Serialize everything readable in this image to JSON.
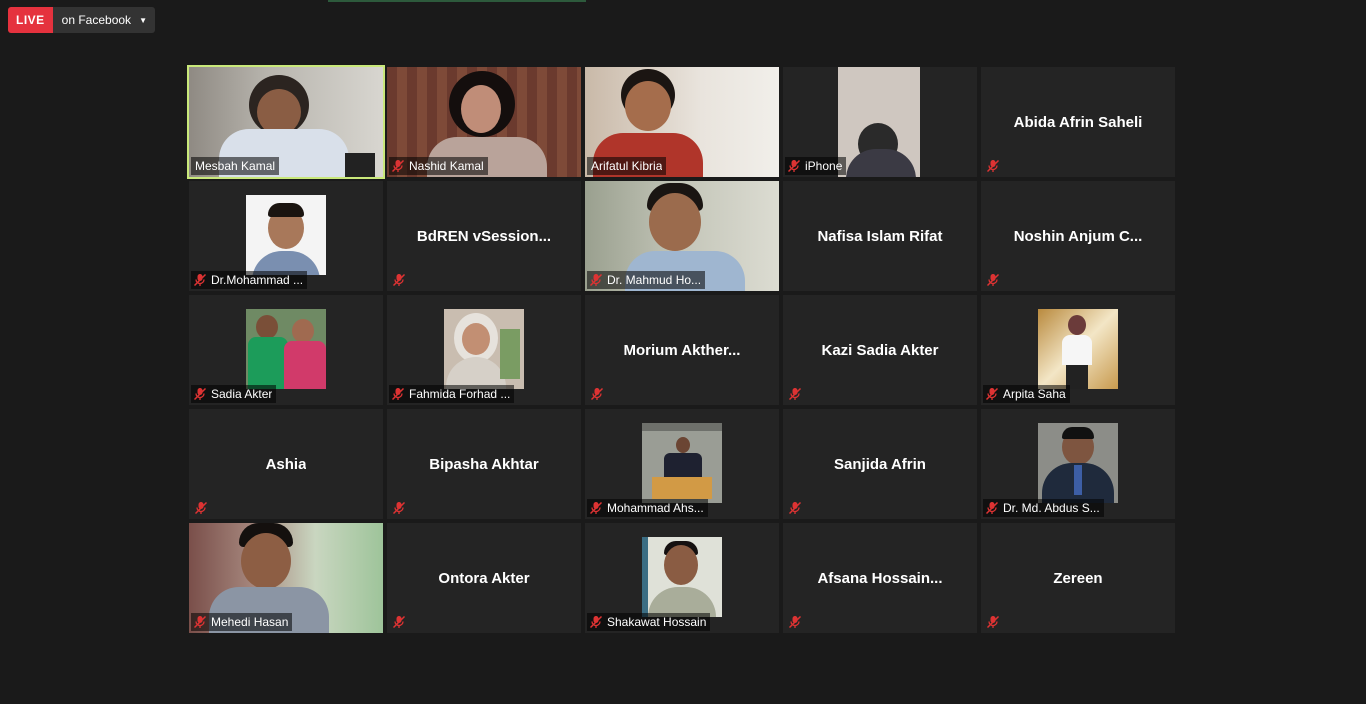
{
  "live": {
    "tag": "LIVE",
    "destination": "on Facebook"
  },
  "colors": {
    "background": "#1a1a1a",
    "tile": "#242424",
    "active_border": "#c9e87a",
    "live_red": "#e5323e"
  },
  "participants": [
    {
      "name": "Mesbah Kamal",
      "video": true,
      "muted": false,
      "active": true
    },
    {
      "name": "Nashid Kamal",
      "video": true,
      "muted": true
    },
    {
      "name": "Arifatul Kibria",
      "video": true,
      "muted": false
    },
    {
      "name": "iPhone",
      "video": false,
      "photo": true,
      "muted": true
    },
    {
      "name": "Abida Afrin Saheli",
      "video": false,
      "muted": true
    },
    {
      "name": "Dr.Mohammad ...",
      "video": false,
      "photo": true,
      "muted": true
    },
    {
      "name": "BdREN vSession...",
      "video": false,
      "muted": true
    },
    {
      "name": "Dr. Mahmud Ho...",
      "video": true,
      "muted": true
    },
    {
      "name": "Nafisa Islam Rifat",
      "video": false,
      "muted": false
    },
    {
      "name": "Noshin Anjum C...",
      "video": false,
      "muted": true
    },
    {
      "name": "Sadia Akter",
      "video": false,
      "photo": true,
      "muted": true
    },
    {
      "name": "Fahmida Forhad ...",
      "video": false,
      "photo": true,
      "muted": true
    },
    {
      "name": "Morium Akther...",
      "video": false,
      "muted": true
    },
    {
      "name": "Kazi Sadia Akter",
      "video": false,
      "muted": true
    },
    {
      "name": "Arpita Saha",
      "video": false,
      "photo": true,
      "muted": true
    },
    {
      "name": "Ashia",
      "video": false,
      "muted": true
    },
    {
      "name": "Bipasha Akhtar",
      "video": false,
      "muted": true
    },
    {
      "name": "Mohammad Ahs...",
      "video": false,
      "photo": true,
      "muted": true
    },
    {
      "name": "Sanjida Afrin",
      "video": false,
      "muted": true
    },
    {
      "name": "Dr. Md. Abdus S...",
      "video": false,
      "photo": true,
      "muted": true
    },
    {
      "name": "Mehedi Hasan",
      "video": true,
      "muted": true
    },
    {
      "name": "Ontora Akter",
      "video": false,
      "muted": true
    },
    {
      "name": "Shakawat Hossain",
      "video": false,
      "photo": true,
      "muted": true
    },
    {
      "name": "Afsana Hossain...",
      "video": false,
      "muted": true
    },
    {
      "name": "Zereen",
      "video": false,
      "muted": true
    }
  ]
}
